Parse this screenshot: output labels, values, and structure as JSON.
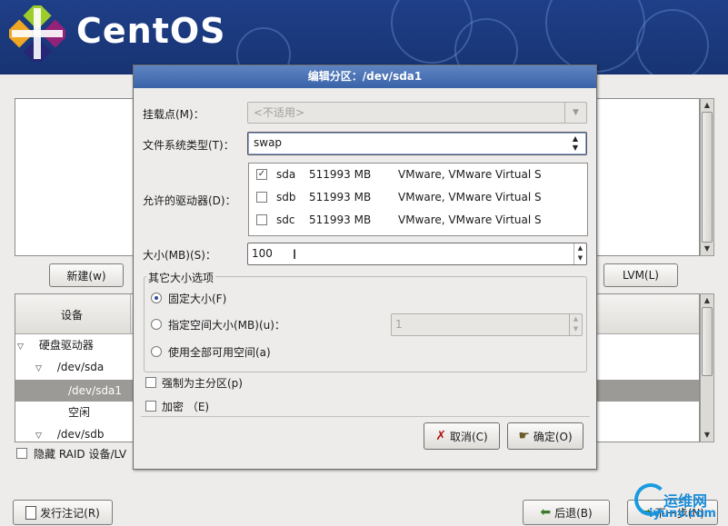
{
  "brand": {
    "name": "CentOS"
  },
  "background": {
    "new_button": "新建(w)",
    "lvm_button": "LVM(L)",
    "tree_header": {
      "device": "设备"
    },
    "tree_rows": [
      {
        "label": "硬盘驱动器",
        "level": 0,
        "expanded": true
      },
      {
        "label": "/dev/sda",
        "level": 1,
        "expanded": true
      },
      {
        "label": "/dev/sda1",
        "level": 2,
        "selected": true
      },
      {
        "label": "空闲",
        "level": 2
      },
      {
        "label": "/dev/sdb",
        "level": 1,
        "expanded": true
      }
    ],
    "hide_raid_label": "隐藏 RAID 设备/LV",
    "release_notes_button": "发行注记(R)",
    "back_button": "后退(B)",
    "next_button": "下一步(N)"
  },
  "dialog": {
    "title": "编辑分区：/dev/sda1",
    "mount_point_label": "挂载点(M)：",
    "mount_point_value": "<不适用>",
    "fs_type_label": "文件系统类型(T)：",
    "fs_type_value": "swap",
    "drives_label": "允许的驱动器(D)：",
    "drives": [
      {
        "name": "sda",
        "size": "511993 MB",
        "model": "VMware, VMware Virtual S",
        "checked": true
      },
      {
        "name": "sdb",
        "size": "511993 MB",
        "model": "VMware, VMware Virtual S",
        "checked": false
      },
      {
        "name": "sdc",
        "size": "511993 MB",
        "model": "VMware, VMware Virtual S",
        "checked": false
      }
    ],
    "size_label": "大小(MB)(S)：",
    "size_value": "100",
    "other_size_title": "其它大小选项",
    "fixed_size_label": "固定大小(F)",
    "fill_max_label": "指定空间大小(MB)(u)：",
    "fill_max_value": "1",
    "fill_all_label": "使用全部可用空间(a)",
    "primary_label": "强制为主分区(p)",
    "encrypt_label": "加密 （E)",
    "cancel_button": "取消(C)",
    "ok_button": "确定(O)"
  },
  "watermark": {
    "line1": "运维网",
    "line2": "iyunv.com"
  },
  "colors": {
    "banner": "#1f3f88",
    "title_bar": "#4a71b5",
    "selection": "#9c9a96"
  }
}
